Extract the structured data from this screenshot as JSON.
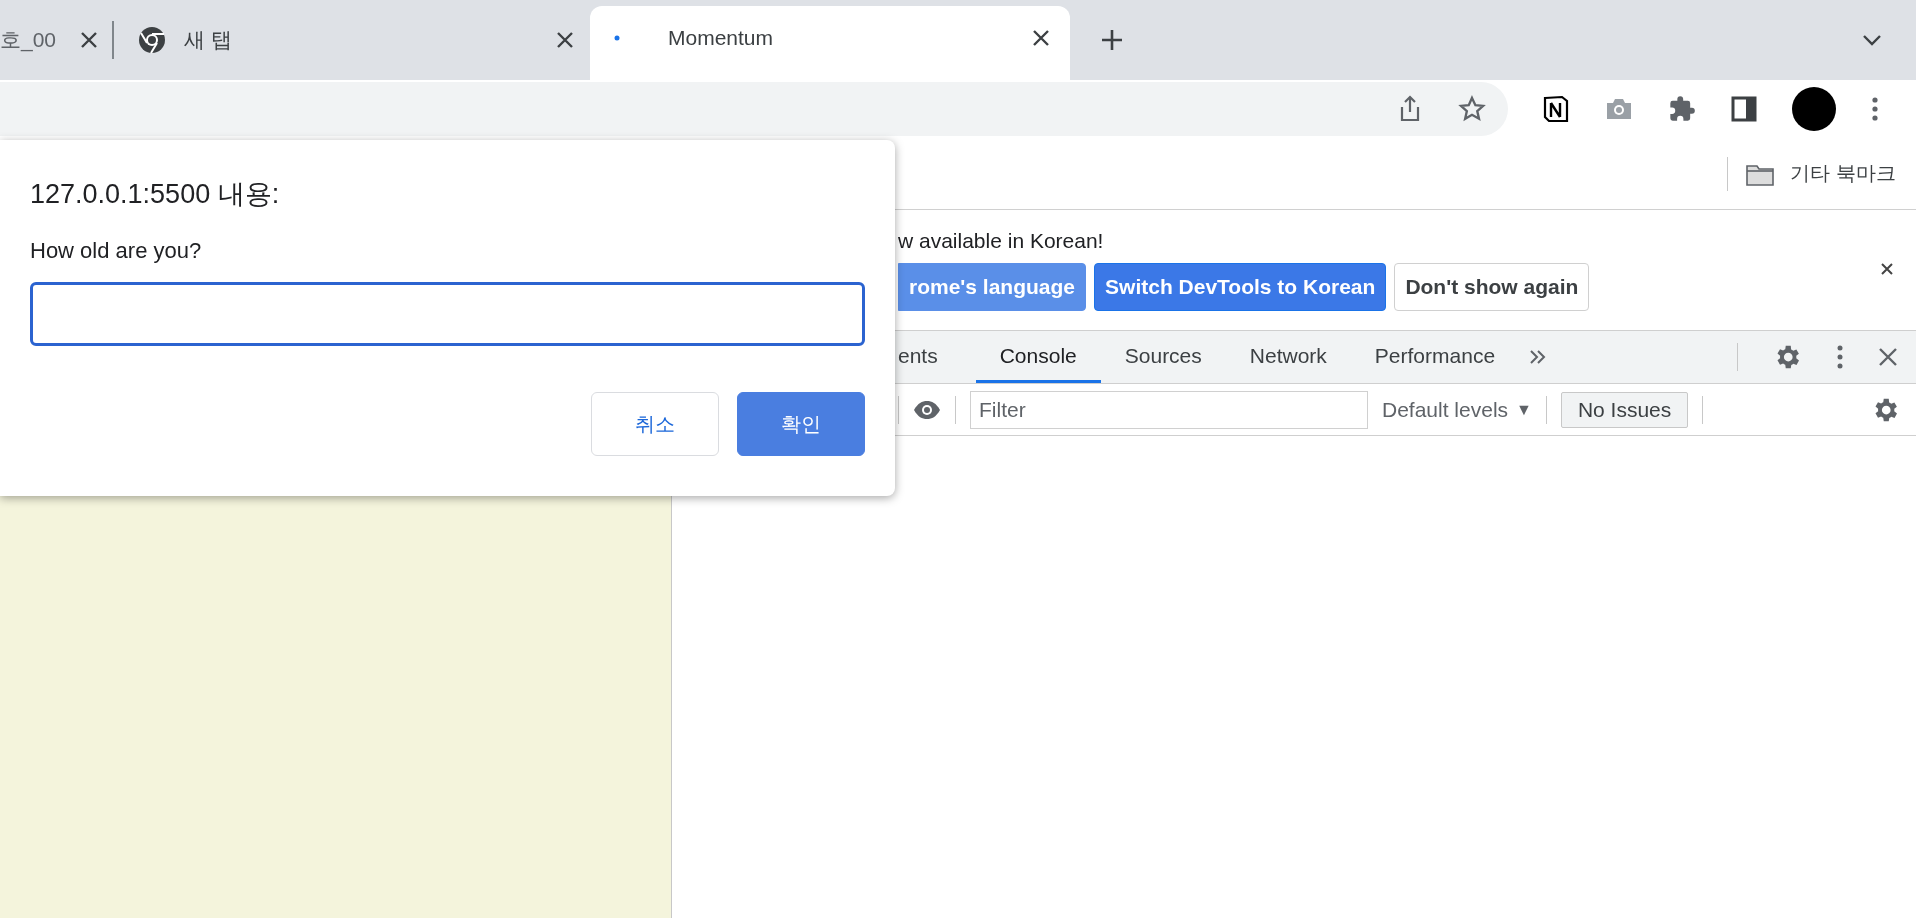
{
  "tabs": [
    {
      "title": "호_00",
      "kind": "plain",
      "selected": false
    },
    {
      "title": "새 탭",
      "kind": "chrome",
      "selected": false
    },
    {
      "title": "Momentum",
      "kind": "dot",
      "selected": true
    }
  ],
  "bookmarks": [
    {
      "label": "기타 북마크"
    }
  ],
  "devtools": {
    "infobar": {
      "message": "w available in Korean!",
      "buttons": [
        {
          "label": "rome's language",
          "kind": "light"
        },
        {
          "label": "Switch DevTools to Korean",
          "kind": "primary"
        },
        {
          "label": "Don't show again",
          "kind": "plain"
        }
      ]
    },
    "tabs": [
      {
        "label": "ents",
        "selected": false
      },
      {
        "label": "Console",
        "selected": true
      },
      {
        "label": "Sources",
        "selected": false
      },
      {
        "label": "Network",
        "selected": false
      },
      {
        "label": "Performance",
        "selected": false
      }
    ],
    "filter": {
      "placeholder": "Filter"
    },
    "levels": {
      "label": "Default levels",
      "arrow": "▼"
    },
    "issues": "No Issues"
  },
  "dialog": {
    "title": "127.0.0.1:5500 내용:",
    "message": "How old are you?",
    "buttons": [
      {
        "label": "취소",
        "kind": "plain"
      },
      {
        "label": "확인",
        "kind": "primary"
      }
    ]
  }
}
